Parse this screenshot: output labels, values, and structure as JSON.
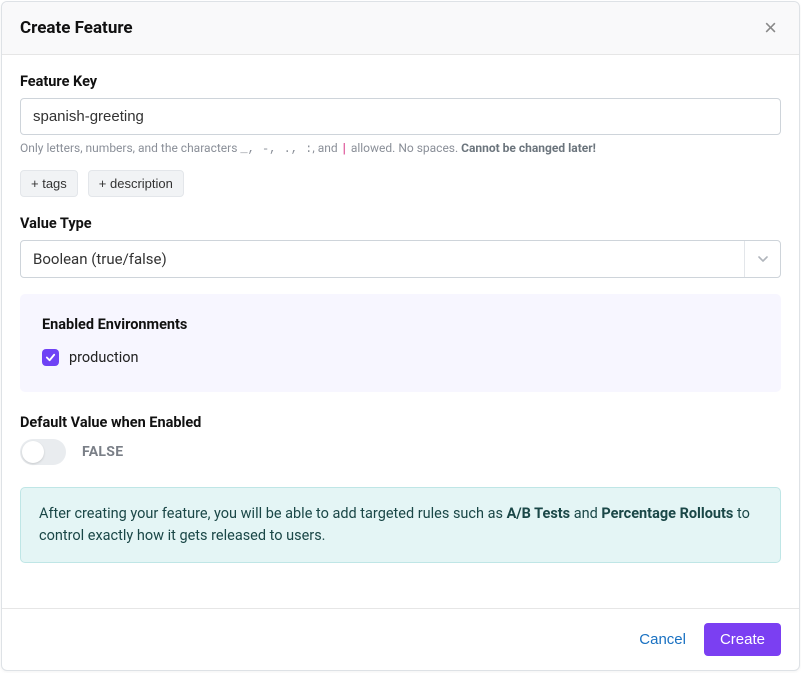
{
  "modal": {
    "title": "Create Feature"
  },
  "feature_key": {
    "label": "Feature Key",
    "value": "spanish-greeting",
    "help_prefix": "Only letters, numbers, and the characters ",
    "help_chars": "_, -, ., :",
    "help_mid": ", and ",
    "help_pipe": "|",
    "help_suffix": " allowed. No spaces. ",
    "help_strong": "Cannot be changed later!"
  },
  "pills": {
    "tags": "+ tags",
    "description": "+ description"
  },
  "value_type": {
    "label": "Value Type",
    "selected": "Boolean (true/false)"
  },
  "environments": {
    "title": "Enabled Environments",
    "items": [
      {
        "label": "production",
        "checked": true
      }
    ]
  },
  "default_value": {
    "label": "Default Value when Enabled",
    "state": "FALSE"
  },
  "info": {
    "prefix": "After creating your feature, you will be able to add targeted rules such as ",
    "ab": "A/B Tests",
    "mid": " and ",
    "pr": "Percentage Rollouts",
    "suffix": " to control exactly how it gets released to users."
  },
  "footer": {
    "cancel": "Cancel",
    "create": "Create"
  }
}
